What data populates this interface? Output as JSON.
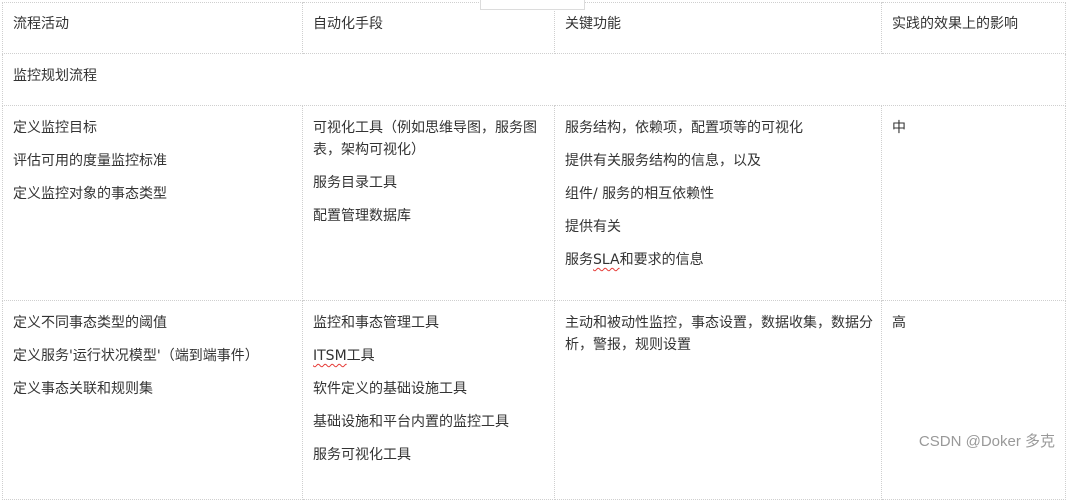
{
  "table": {
    "headers": [
      "流程活动",
      "自动化手段",
      "关键功能",
      "实践的效果上的影响"
    ],
    "section_title": "监控规划流程",
    "rows": [
      {
        "activities": [
          "定义监控目标",
          "评估可用的度量监控标准",
          "定义监控对象的事态类型"
        ],
        "automation": [
          "可视化工具（例如思维导图，服务图表，架构可视化）",
          "服务目录工具",
          "配置管理数据库"
        ],
        "functions": [
          "服务结构，依赖项，配置项等的可视化",
          "提供有关服务结构的信息，以及",
          "组件/ 服务的相互依赖性",
          "提供有关",
          "服务SLA和要求的信息"
        ],
        "impact": "中"
      },
      {
        "activities": [
          "定义不同事态类型的阈值",
          "定义服务'运行状况模型'（端到端事件）",
          "定义事态关联和规则集"
        ],
        "automation": [
          "监控和事态管理工具",
          "ITSM工具",
          "软件定义的基础设施工具",
          "基础设施和平台内置的监控工具",
          "服务可视化工具"
        ],
        "functions": [
          "主动和被动性监控，事态设置，数据收集，数据分析，警报，规则设置"
        ],
        "impact": "高"
      }
    ]
  },
  "watermark": "CSDN @Doker 多克"
}
